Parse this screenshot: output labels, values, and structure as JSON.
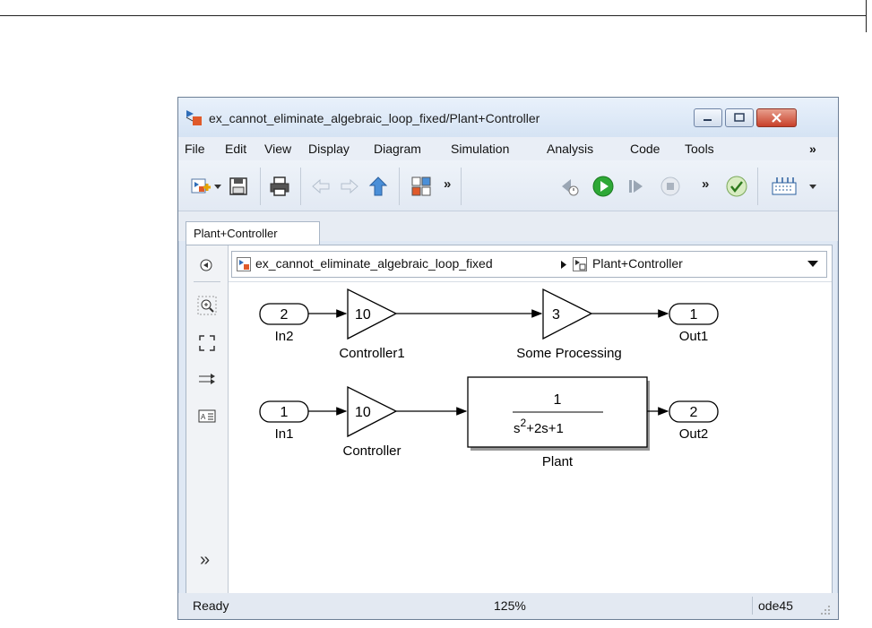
{
  "window": {
    "title": "ex_cannot_eliminate_algebraic_loop_fixed/Plant+Controller"
  },
  "menu": [
    "File",
    "Edit",
    "View",
    "Display",
    "Diagram",
    "Simulation",
    "Analysis",
    "Code",
    "Tools",
    "»"
  ],
  "toolbar": {
    "more1": "»",
    "more2": "»"
  },
  "tab": {
    "label": "Plant+Controller"
  },
  "address": {
    "model": "ex_cannot_eliminate_algebraic_loop_fixed",
    "subsystem": "Plant+Controller"
  },
  "diagram": {
    "in2_port": "2",
    "in2_label": "In2",
    "gain1_value": "10",
    "gain1_label": "Controller1",
    "gain3_value": "3",
    "gain3_label": "Some Processing",
    "out1_port": "1",
    "out1_label": "Out1",
    "in1_port": "1",
    "in1_label": "In1",
    "gain2_value": "10",
    "gain2_label": "Controller",
    "tf_num": "1",
    "tf_den_a": "s",
    "tf_den_exp": "2",
    "tf_den_b": "+2s+1",
    "plant_label": "Plant",
    "out2_port": "2",
    "out2_label": "Out2"
  },
  "lefttool": {
    "more": "»"
  },
  "status": {
    "state": "Ready",
    "zoom": "125%",
    "solver": "ode45"
  },
  "colors": {
    "title_bg": "#dfe8f4",
    "close": "#c8402a",
    "run": "#2ea836"
  }
}
